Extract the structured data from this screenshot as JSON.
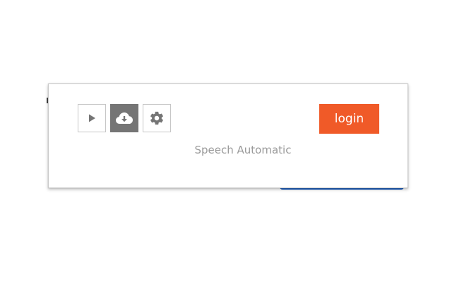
{
  "popup": {
    "caption": "Speech Automatic",
    "login_label": "login",
    "buttons": [
      {
        "name": "play",
        "icon": "play-icon"
      },
      {
        "name": "download",
        "icon": "cloud-download-icon",
        "active": true
      },
      {
        "name": "settings",
        "icon": "gear-icon"
      }
    ]
  },
  "colors": {
    "login_bg": "#f05a28",
    "active_button_bg": "#757575",
    "icon_gray": "#757575",
    "caption_text": "#9a9a9a",
    "underlay_accent": "#1a5fc4"
  }
}
